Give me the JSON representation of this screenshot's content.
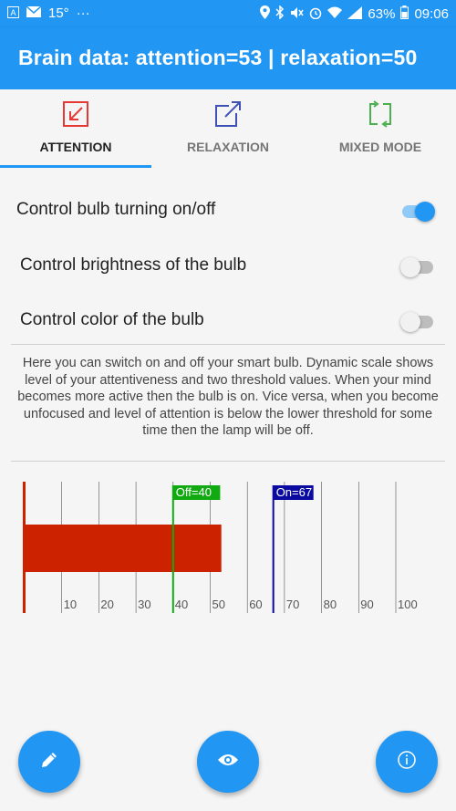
{
  "status_bar": {
    "temperature": "15°",
    "dots": "···",
    "battery_percent": "63%",
    "time": "09:06"
  },
  "app_bar": {
    "title": "Brain data: attention=53 | relaxation=50"
  },
  "tabs": [
    {
      "label": "ATTENTION",
      "icon": "arrow-down-left-icon",
      "icon_color": "#e53935",
      "active": true
    },
    {
      "label": "RELAXATION",
      "icon": "arrow-up-right-icon",
      "icon_color": "#3f51b5",
      "active": false
    },
    {
      "label": "MIXED MODE",
      "icon": "swap-arrows-icon",
      "icon_color": "#4caf50",
      "active": false
    }
  ],
  "settings": [
    {
      "label": "Control bulb turning on/off",
      "enabled": true
    },
    {
      "label": "Control brightness of the bulb",
      "enabled": false
    },
    {
      "label": "Control color of the bulb",
      "enabled": false
    }
  ],
  "description": "Here you can switch on and off your smart bulb. Dynamic scale shows level of your attentiveness and two threshold values. When your mind becomes more active then the bulb is on. Vice versa, when you become unfocused and level of attention is below the lower threshold for some time then the lamp will be off.",
  "chart_data": {
    "type": "bar",
    "orientation": "horizontal",
    "values": [
      53
    ],
    "xlim": [
      0,
      100
    ],
    "ticks": [
      10,
      20,
      30,
      40,
      50,
      60,
      70,
      80,
      90,
      100
    ],
    "bar_color": "#cc2200",
    "thresholds": [
      {
        "label": "Off=40",
        "value": 40,
        "color": "#11aa11"
      },
      {
        "label": "On=67",
        "value": 67,
        "color": "#0a0aa0"
      }
    ],
    "grid": true
  },
  "fabs": [
    {
      "icon": "pencil-icon"
    },
    {
      "icon": "eye-icon"
    },
    {
      "icon": "info-icon"
    }
  ],
  "colors": {
    "primary": "#2196f3",
    "background": "#f5f5f5"
  }
}
